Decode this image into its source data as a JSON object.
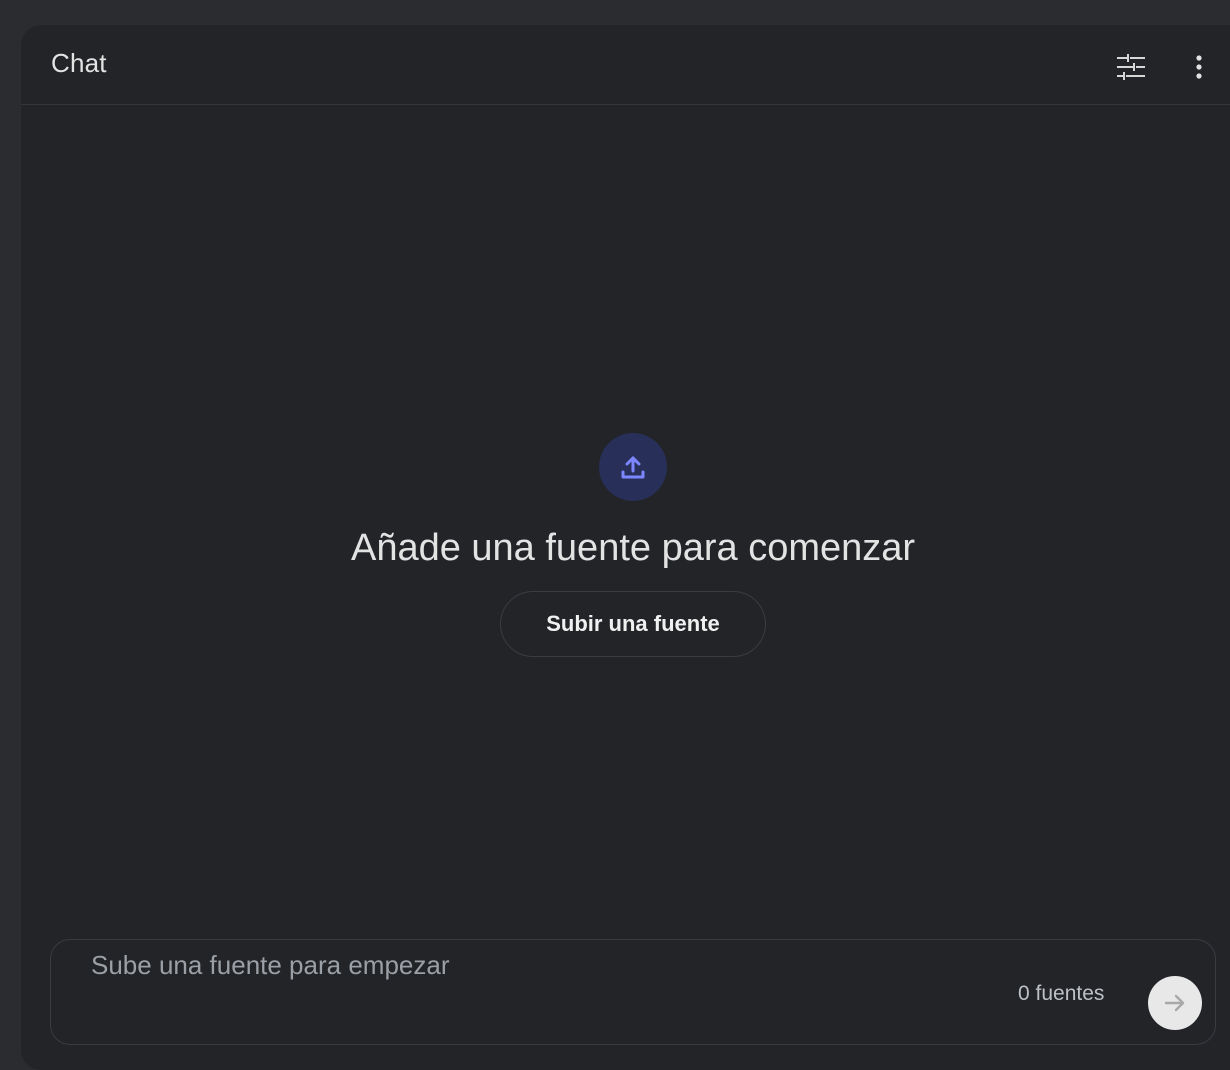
{
  "header": {
    "title": "Chat",
    "icons": {
      "settings": "tune-icon",
      "menu": "more-vert-icon"
    }
  },
  "empty_state": {
    "icon": "upload-icon",
    "headline": "Añade una fuente para comenzar",
    "button_label": "Subir una fuente"
  },
  "composer": {
    "placeholder": "Sube una fuente para empezar",
    "value": "",
    "source_count": "0 fuentes",
    "send_icon": "arrow-forward-icon"
  },
  "colors": {
    "panel_bg": "#222428",
    "outer_bg": "#2b2c30",
    "accent": "#6d7dff",
    "accent_bg": "#28305a",
    "text": "#e3e3e3",
    "muted_text": "#9aa0a6",
    "send_button_bg": "#e8e8e8"
  }
}
